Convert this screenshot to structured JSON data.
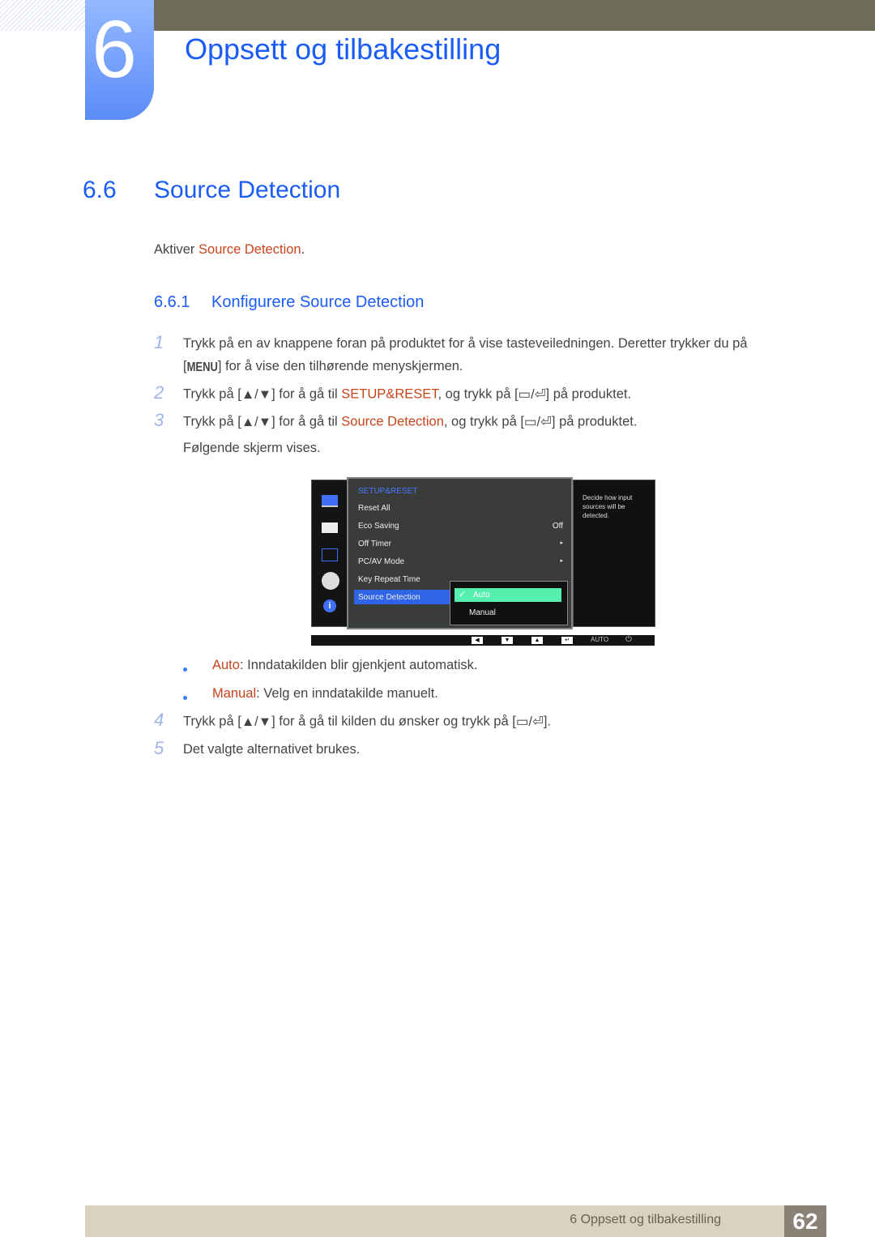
{
  "header": {
    "chapter_number": "6",
    "chapter_title": "Oppsett og tilbakestilling"
  },
  "section": {
    "number": "6.6",
    "title": "Source Detection"
  },
  "intro": {
    "prefix": "Aktiver ",
    "highlight": "Source Detection",
    "suffix": "."
  },
  "subsection": {
    "number": "6.6.1",
    "title": "Konfigurere Source Detection"
  },
  "steps": [
    {
      "num": "1",
      "line1": "Trykk på en av knappene foran på produktet for å vise tasteveiledningen. Deretter trykker du på",
      "key": "MENU",
      "line2": "] for å vise den tilhørende menyskjermen."
    },
    {
      "num": "2",
      "prefix": "Trykk på [",
      "mid": "] for å gå til ",
      "highlight": "SETUP&RESET",
      "after": ", og trykk på [",
      "end": "] på produktet."
    },
    {
      "num": "3",
      "prefix": "Trykk på [",
      "mid": "] for å gå til ",
      "highlight": "Source Detection",
      "after": ", og trykk på [",
      "end": "] på produktet.",
      "line2": "Følgende skjerm vises."
    },
    {
      "num": "4",
      "prefix": "Trykk på [",
      "mid": "] for å gå til kilden du ønsker og trykk på [",
      "end": "]."
    },
    {
      "num": "5",
      "text": "Det valgte alternativet brukes."
    }
  ],
  "options": [
    {
      "name": "Auto",
      "desc": ": Inndatakilden blir gjenkjent automatisk."
    },
    {
      "name": "Manual",
      "desc": ": Velg en inndatakilde manuelt."
    }
  ],
  "osd": {
    "menu_title": "SETUP&RESET",
    "items": [
      {
        "label": "Reset All",
        "value": ""
      },
      {
        "label": "Eco Saving",
        "value": "Off"
      },
      {
        "label": "Off Timer",
        "value": "▸"
      },
      {
        "label": "PC/AV Mode",
        "value": "▸"
      },
      {
        "label": "Key Repeat Time",
        "value": ""
      },
      {
        "label": "Source Detection",
        "value": ""
      }
    ],
    "submenu": [
      {
        "label": "Auto",
        "checked": true
      },
      {
        "label": "Manual"
      }
    ],
    "help": "Decide how input sources will be detected.",
    "buttons": {
      "auto": "AUTO"
    }
  },
  "footer": {
    "text": "6 Oppsett og tilbakestilling",
    "page": "62"
  }
}
